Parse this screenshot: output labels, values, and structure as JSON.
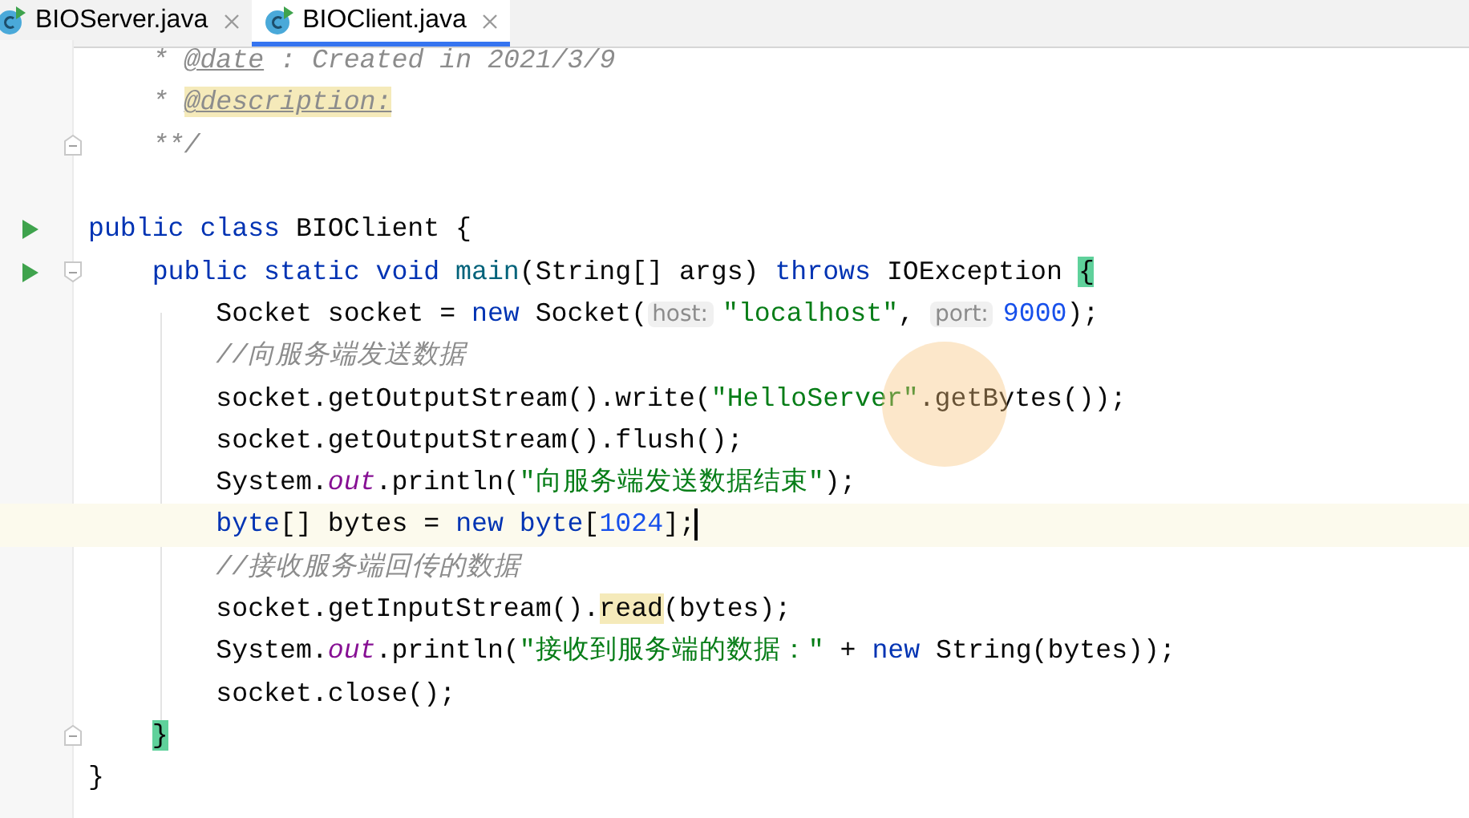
{
  "tabs": [
    {
      "label": "BIOServer.java",
      "selected": false
    },
    {
      "label": "BIOClient.java",
      "selected": true
    }
  ],
  "lines": [
    {
      "tokens": [
        {
          "kind": "doc",
          "text": "    * "
        },
        {
          "kind": "doctag",
          "text": "@date"
        },
        {
          "kind": "doc",
          "text": " : Created in 2021/3/9"
        }
      ]
    },
    {
      "tokens": [
        {
          "kind": "doc",
          "text": "    * "
        },
        {
          "kind": "doctag",
          "text": "@description:",
          "matched": true
        }
      ]
    },
    {
      "fold_end": true,
      "tokens": [
        {
          "kind": "doc",
          "text": "    **/"
        }
      ]
    },
    {
      "gap_before": true,
      "run": true,
      "tokens": [
        {
          "kind": "keyword",
          "text": "public class "
        },
        {
          "kind": "plain",
          "text": "BIOClient {"
        }
      ]
    },
    {
      "run": true,
      "fold_start": true,
      "tokens": [
        {
          "kind": "keyword",
          "text": "    public static void "
        },
        {
          "kind": "method",
          "text": "main"
        },
        {
          "kind": "plain",
          "text": "(String[] args) "
        },
        {
          "kind": "keyword",
          "text": "throws "
        },
        {
          "kind": "plain",
          "text": "IOException "
        },
        {
          "kind": "plain",
          "text": "{",
          "brace_match": true
        }
      ]
    },
    {
      "tokens": [
        {
          "kind": "plain",
          "text": "        Socket socket = "
        },
        {
          "kind": "keyword",
          "text": "new "
        },
        {
          "kind": "plain",
          "text": "Socket("
        },
        {
          "kind": "hint",
          "text": "host:"
        },
        {
          "kind": "string",
          "text": "\"localhost\""
        },
        {
          "kind": "plain",
          "text": ", "
        },
        {
          "kind": "hint",
          "text": "port:"
        },
        {
          "kind": "number",
          "text": "9000"
        },
        {
          "kind": "plain",
          "text": ");"
        }
      ]
    },
    {
      "tokens": [
        {
          "kind": "comment",
          "text": "        //向服务端发送数据"
        }
      ]
    },
    {
      "tokens": [
        {
          "kind": "plain",
          "text": "        socket.getOutputStream().write("
        },
        {
          "kind": "string",
          "text": "\"HelloServer\""
        },
        {
          "kind": "plain",
          "text": ".getBytes());"
        }
      ]
    },
    {
      "tokens": [
        {
          "kind": "plain",
          "text": "        socket.getOutputStream().flush();"
        }
      ]
    },
    {
      "tokens": [
        {
          "kind": "plain",
          "text": "        System."
        },
        {
          "kind": "field",
          "text": "out"
        },
        {
          "kind": "plain",
          "text": ".println("
        },
        {
          "kind": "string",
          "text": "\"向服务端发送数据结束\""
        },
        {
          "kind": "plain",
          "text": ");"
        }
      ]
    },
    {
      "current": true,
      "tokens": [
        {
          "kind": "keyword",
          "text": "        byte"
        },
        {
          "kind": "plain",
          "text": "[] bytes = "
        },
        {
          "kind": "keyword",
          "text": "new byte"
        },
        {
          "kind": "plain",
          "text": "["
        },
        {
          "kind": "number",
          "text": "1024"
        },
        {
          "kind": "plain",
          "text": "];"
        }
      ]
    },
    {
      "tokens": [
        {
          "kind": "comment",
          "text": "        //接收服务端回传的数据"
        }
      ]
    },
    {
      "tokens": [
        {
          "kind": "plain",
          "text": "        socket.getInputStream()."
        },
        {
          "kind": "plain",
          "text": "read",
          "matched": true
        },
        {
          "kind": "plain",
          "text": "(bytes);"
        }
      ]
    },
    {
      "tokens": [
        {
          "kind": "plain",
          "text": "        System."
        },
        {
          "kind": "field",
          "text": "out"
        },
        {
          "kind": "plain",
          "text": ".println("
        },
        {
          "kind": "string",
          "text": "\"接收到服务端的数据：\""
        },
        {
          "kind": "plain",
          "text": " + "
        },
        {
          "kind": "keyword",
          "text": "new "
        },
        {
          "kind": "plain",
          "text": "String(bytes));"
        }
      ]
    },
    {
      "tokens": [
        {
          "kind": "plain",
          "text": "        socket.close();"
        }
      ]
    },
    {
      "fold_end": true,
      "tokens": [
        {
          "kind": "plain",
          "text": "    }",
          "brace_match": true
        }
      ]
    },
    {
      "tokens": [
        {
          "kind": "plain",
          "text": "}"
        }
      ]
    }
  ]
}
